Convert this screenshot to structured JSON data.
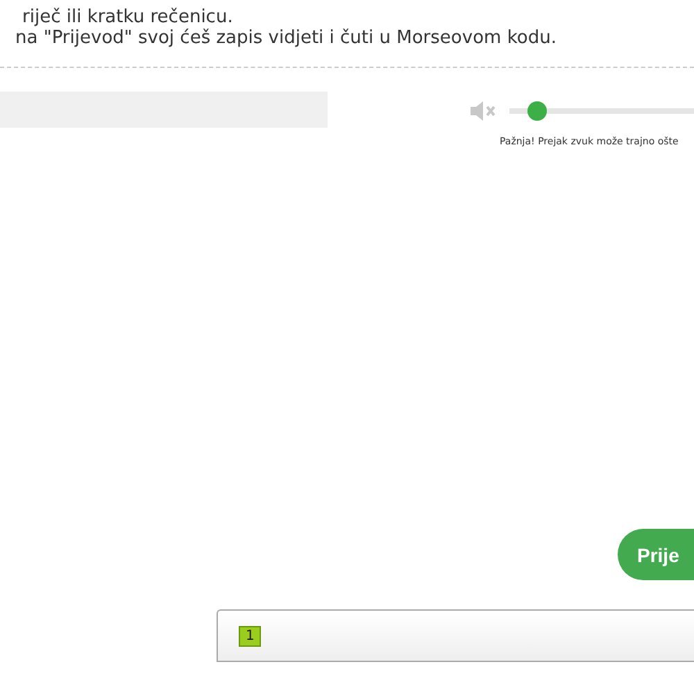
{
  "instructions": [
    "riječ ili kratku rečenicu.",
    "na \"Prijevod\" svoj ćeš zapis vidjeti i čuti u Morseovom kodu."
  ],
  "volume": {
    "muted": true,
    "level": 0.15,
    "warning": "Pažnja! Prejak zvuk može trajno ošte"
  },
  "translate_button": {
    "label": "Prije"
  },
  "output_panel": {
    "line_number": "1"
  }
}
